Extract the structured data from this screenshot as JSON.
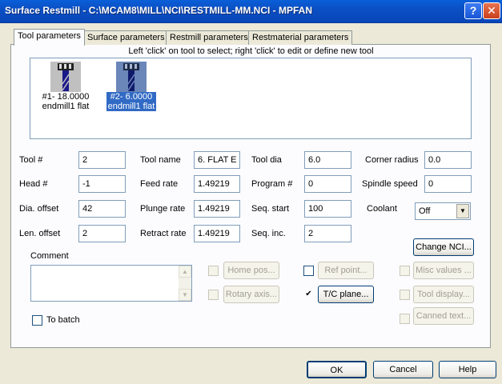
{
  "window": {
    "title": "Surface Restmill - C:\\MCAM8\\MILL\\NCI\\RESTMILL-MM.NCI - MPFAN",
    "help_glyph": "?",
    "close_glyph": "✕"
  },
  "tabs": [
    {
      "label": "Tool parameters",
      "active": true
    },
    {
      "label": "Surface parameters",
      "active": false
    },
    {
      "label": "Restmill parameters",
      "active": false
    },
    {
      "label": "Restmaterial parameters",
      "active": false
    }
  ],
  "tool_hint": "Left 'click' on tool to select; right 'click' to edit or define new tool",
  "tools": [
    {
      "line1": "#1- 18.0000",
      "line2": "endmill1 flat",
      "selected": false
    },
    {
      "line1": "#2- 6.0000",
      "line2": "endmill1 flat",
      "selected": true
    }
  ],
  "fields": {
    "tool_num": {
      "label": "Tool #",
      "value": "2"
    },
    "head_num": {
      "label": "Head #",
      "value": "-1"
    },
    "dia_offset": {
      "label": "Dia. offset",
      "value": "42"
    },
    "len_offset": {
      "label": "Len. offset",
      "value": "2"
    },
    "tool_name": {
      "label": "Tool name",
      "value": "6. FLAT E"
    },
    "feed_rate": {
      "label": "Feed rate",
      "value": "1.49219"
    },
    "plunge_rate": {
      "label": "Plunge rate",
      "value": "1.49219"
    },
    "retract_rate": {
      "label": "Retract rate",
      "value": "1.49219"
    },
    "tool_dia": {
      "label": "Tool dia",
      "value": "6.0"
    },
    "program_num": {
      "label": "Program #",
      "value": "0"
    },
    "seq_start": {
      "label": "Seq. start",
      "value": "100"
    },
    "seq_inc": {
      "label": "Seq. inc.",
      "value": "2"
    },
    "corner_radius": {
      "label": "Corner radius",
      "value": "0.0"
    },
    "spindle_speed": {
      "label": "Spindle speed",
      "value": "0"
    },
    "coolant": {
      "label": "Coolant",
      "value": "Off"
    }
  },
  "comment": {
    "label": "Comment",
    "value": ""
  },
  "buttons": {
    "change_nci": "Change NCI...",
    "home_pos": "Home pos...",
    "rotary_axis": "Rotary axis...",
    "ref_point": "Ref point...",
    "tc_plane": "T/C plane...",
    "misc_values": "Misc values ...",
    "tool_display": "Tool display...",
    "canned_text": "Canned text...",
    "ok": "OK",
    "cancel": "Cancel",
    "help": "Help"
  },
  "checkboxes": {
    "to_batch": {
      "label": "To batch",
      "checked": false
    },
    "home_pos": {
      "checked": false
    },
    "rotary_axis": {
      "checked": false
    },
    "ref_point": {
      "checked": false
    },
    "tc_plane": {
      "checked": true
    },
    "misc_values": {
      "checked": false
    },
    "tool_display": {
      "checked": false
    },
    "canned_text": {
      "checked": false
    }
  },
  "check_glyph": "✔",
  "scroll_up_glyph": "▲",
  "scroll_down_glyph": "▼",
  "combo_arrow_glyph": "▼",
  "colors": {
    "title_bar": "#0b4fc4",
    "selection": "#316ac5",
    "dialog_bg": "#ece9d8"
  }
}
